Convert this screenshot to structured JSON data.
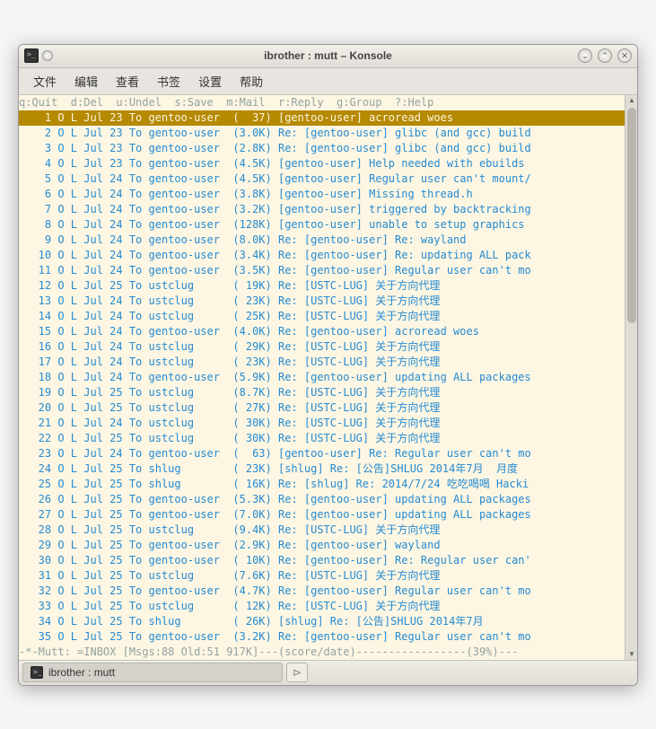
{
  "window": {
    "title": "ibrother : mutt – Konsole"
  },
  "menus": [
    "文件",
    "编辑",
    "查看",
    "书签",
    "设置",
    "帮助"
  ],
  "helpline": "q:Quit  d:Del  u:Undel  s:Save  m:Mail  r:Reply  g:Group  ?:Help",
  "messages": [
    {
      "n": 1,
      "sel": true,
      "date": "Jul 23",
      "to": "gentoo-user",
      "size": "(  37)",
      "subj": "[gentoo-user] acroread woes"
    },
    {
      "n": 2,
      "date": "Jul 23",
      "to": "gentoo-user",
      "size": "(3.0K)",
      "subj": "Re: [gentoo-user] glibc (and gcc) build"
    },
    {
      "n": 3,
      "date": "Jul 23",
      "to": "gentoo-user",
      "size": "(2.8K)",
      "subj": "Re: [gentoo-user] glibc (and gcc) build"
    },
    {
      "n": 4,
      "date": "Jul 23",
      "to": "gentoo-user",
      "size": "(4.5K)",
      "subj": "[gentoo-user] Help needed with ebuilds"
    },
    {
      "n": 5,
      "date": "Jul 24",
      "to": "gentoo-user",
      "size": "(4.5K)",
      "subj": "[gentoo-user] Regular user can't mount/"
    },
    {
      "n": 6,
      "date": "Jul 24",
      "to": "gentoo-user",
      "size": "(3.8K)",
      "subj": "[gentoo-user] Missing thread.h"
    },
    {
      "n": 7,
      "date": "Jul 24",
      "to": "gentoo-user",
      "size": "(3.2K)",
      "subj": "[gentoo-user] triggered by backtracking"
    },
    {
      "n": 8,
      "date": "Jul 24",
      "to": "gentoo-user",
      "size": "(128K)",
      "subj": "[gentoo-user] unable to setup graphics"
    },
    {
      "n": 9,
      "date": "Jul 24",
      "to": "gentoo-user",
      "size": "(8.0K)",
      "subj": "Re: [gentoo-user] Re: wayland"
    },
    {
      "n": 10,
      "date": "Jul 24",
      "to": "gentoo-user",
      "size": "(3.4K)",
      "subj": "Re: [gentoo-user] Re: updating ALL pack"
    },
    {
      "n": 11,
      "date": "Jul 24",
      "to": "gentoo-user",
      "size": "(3.5K)",
      "subj": "Re: [gentoo-user] Regular user can't mo"
    },
    {
      "n": 12,
      "date": "Jul 25",
      "to": "ustclug    ",
      "size": "( 19K)",
      "subj": "Re: [USTC-LUG] 关于方向代理"
    },
    {
      "n": 13,
      "date": "Jul 24",
      "to": "ustclug    ",
      "size": "( 23K)",
      "subj": "Re: [USTC-LUG] 关于方向代理"
    },
    {
      "n": 14,
      "date": "Jul 24",
      "to": "ustclug    ",
      "size": "( 25K)",
      "subj": "Re: [USTC-LUG] 关于方向代理"
    },
    {
      "n": 15,
      "date": "Jul 24",
      "to": "gentoo-user",
      "size": "(4.0K)",
      "subj": "Re: [gentoo-user] acroread woes"
    },
    {
      "n": 16,
      "date": "Jul 24",
      "to": "ustclug    ",
      "size": "( 29K)",
      "subj": "Re: [USTC-LUG] 关于方向代理"
    },
    {
      "n": 17,
      "date": "Jul 24",
      "to": "ustclug    ",
      "size": "( 23K)",
      "subj": "Re: [USTC-LUG] 关于方向代理"
    },
    {
      "n": 18,
      "date": "Jul 24",
      "to": "gentoo-user",
      "size": "(5.9K)",
      "subj": "Re: [gentoo-user] updating ALL packages"
    },
    {
      "n": 19,
      "date": "Jul 25",
      "to": "ustclug    ",
      "size": "(8.7K)",
      "subj": "Re: [USTC-LUG] 关于方向代理"
    },
    {
      "n": 20,
      "date": "Jul 25",
      "to": "ustclug    ",
      "size": "( 27K)",
      "subj": "Re: [USTC-LUG] 关于方向代理"
    },
    {
      "n": 21,
      "date": "Jul 24",
      "to": "ustclug    ",
      "size": "( 30K)",
      "subj": "Re: [USTC-LUG] 关于方向代理"
    },
    {
      "n": 22,
      "date": "Jul 25",
      "to": "ustclug    ",
      "size": "( 30K)",
      "subj": "Re: [USTC-LUG] 关于方向代理"
    },
    {
      "n": 23,
      "date": "Jul 24",
      "to": "gentoo-user",
      "size": "(  63)",
      "subj": "[gentoo-user] Re: Regular user can't mo"
    },
    {
      "n": 24,
      "date": "Jul 25",
      "to": "shlug      ",
      "size": "( 23K)",
      "subj": "[shlug] Re: [公告]SHLUG 2014年7月  月度"
    },
    {
      "n": 25,
      "date": "Jul 25",
      "to": "shlug      ",
      "size": "( 16K)",
      "subj": "Re: [shlug] Re: 2014/7/24 吃吃喝喝 Hacki"
    },
    {
      "n": 26,
      "date": "Jul 25",
      "to": "gentoo-user",
      "size": "(5.3K)",
      "subj": "Re: [gentoo-user] updating ALL packages"
    },
    {
      "n": 27,
      "date": "Jul 25",
      "to": "gentoo-user",
      "size": "(7.0K)",
      "subj": "Re: [gentoo-user] updating ALL packages"
    },
    {
      "n": 28,
      "date": "Jul 25",
      "to": "ustclug    ",
      "size": "(9.4K)",
      "subj": "Re: [USTC-LUG] 关于方向代理"
    },
    {
      "n": 29,
      "date": "Jul 25",
      "to": "gentoo-user",
      "size": "(2.9K)",
      "subj": "Re: [gentoo-user] wayland"
    },
    {
      "n": 30,
      "date": "Jul 25",
      "to": "gentoo-user",
      "size": "( 10K)",
      "subj": "Re: [gentoo-user] Re: Regular user can'"
    },
    {
      "n": 31,
      "date": "Jul 25",
      "to": "ustclug    ",
      "size": "(7.6K)",
      "subj": "Re: [USTC-LUG] 关于方向代理"
    },
    {
      "n": 32,
      "date": "Jul 25",
      "to": "gentoo-user",
      "size": "(4.7K)",
      "subj": "Re: [gentoo-user] Regular user can't mo"
    },
    {
      "n": 33,
      "date": "Jul 25",
      "to": "ustclug    ",
      "size": "( 12K)",
      "subj": "Re: [USTC-LUG] 关于方向代理"
    },
    {
      "n": 34,
      "date": "Jul 25",
      "to": "shlug      ",
      "size": "( 26K)",
      "subj": "[shlug] Re: [公告]SHLUG 2014年7月"
    },
    {
      "n": 35,
      "date": "Jul 25",
      "to": "gentoo-user",
      "size": "(3.2K)",
      "subj": "Re: [gentoo-user] Regular user can't mo"
    }
  ],
  "statusline": "-*-Mutt: =INBOX [Msgs:88 Old:51 917K]---(score/date)-----------------(39%)---",
  "taskbar": {
    "tab_label": "ibrother : mutt"
  }
}
